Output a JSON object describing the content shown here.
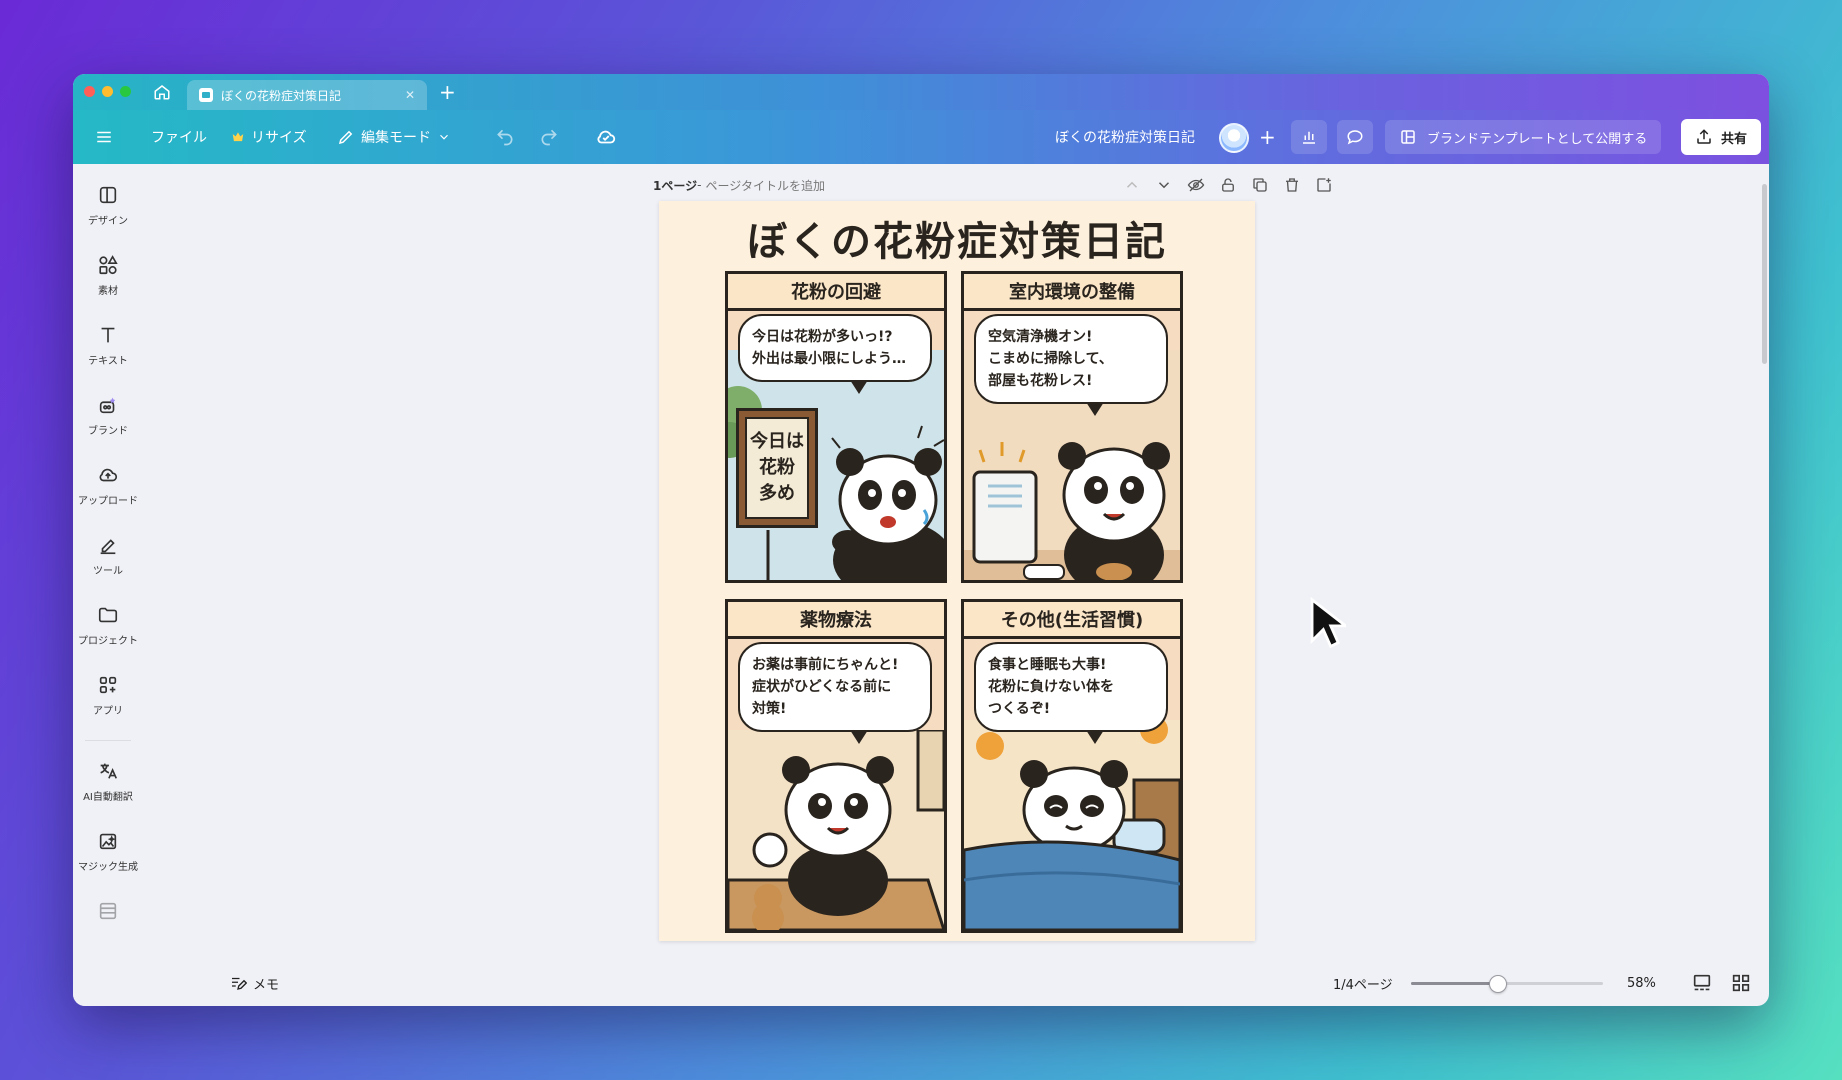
{
  "tab": {
    "title": "ぼくの花粉症対策日記"
  },
  "toolbar": {
    "file": "ファイル",
    "resize": "リサイズ",
    "edit_mode": "編集モード",
    "doc_title": "ぼくの花粉症対策日記",
    "publish": "ブランドテンプレートとして公開する",
    "share": "共有"
  },
  "sidebar": {
    "items": [
      {
        "label": "デザイン",
        "icon": "layout-icon"
      },
      {
        "label": "素材",
        "icon": "shapes-icon"
      },
      {
        "label": "テキスト",
        "icon": "text-icon"
      },
      {
        "label": "ブランド",
        "icon": "brand-icon"
      },
      {
        "label": "アップロード",
        "icon": "cloud-upload-icon"
      },
      {
        "label": "ツール",
        "icon": "pen-tool-icon"
      },
      {
        "label": "プロジェクト",
        "icon": "folder-icon"
      },
      {
        "label": "アプリ",
        "icon": "apps-icon"
      },
      {
        "label": "AI自動翻訳",
        "icon": "translate-icon"
      },
      {
        "label": "マジック生成",
        "icon": "magic-image-icon"
      }
    ]
  },
  "page_header": {
    "page_number": "1ページ",
    "separator": " - ",
    "title_placeholder": "ページタイトルを追加"
  },
  "comic": {
    "title": "ぼくの花粉症対策日記",
    "panels": [
      {
        "heading": "花粉の回避",
        "speech": "今日は花粉が多いっ!?\n外出は最小限にしよう…",
        "sign": [
          "今日は",
          "花粉",
          "多め"
        ]
      },
      {
        "heading": "室内環境の整備",
        "speech": "空気清浄機オン!\nこまめに掃除して、\n部屋も花粉レス!"
      },
      {
        "heading": "薬物療法",
        "speech": "お薬は事前にちゃんと!\n症状がひどくなる前に\n対策!"
      },
      {
        "heading": "その他(生活習慣)",
        "speech": "食事と睡眠も大事!\n花粉に負けない体を\nつくるぞ!"
      }
    ]
  },
  "bottom": {
    "memo": "メモ",
    "page_count": "1/4ページ",
    "zoom": "58%",
    "zoom_level": 0.45
  },
  "colors": {
    "accent": "#7d2ae8",
    "toolbar_start": "#25b9c6",
    "canvas_bg": "#fdf0dc"
  }
}
